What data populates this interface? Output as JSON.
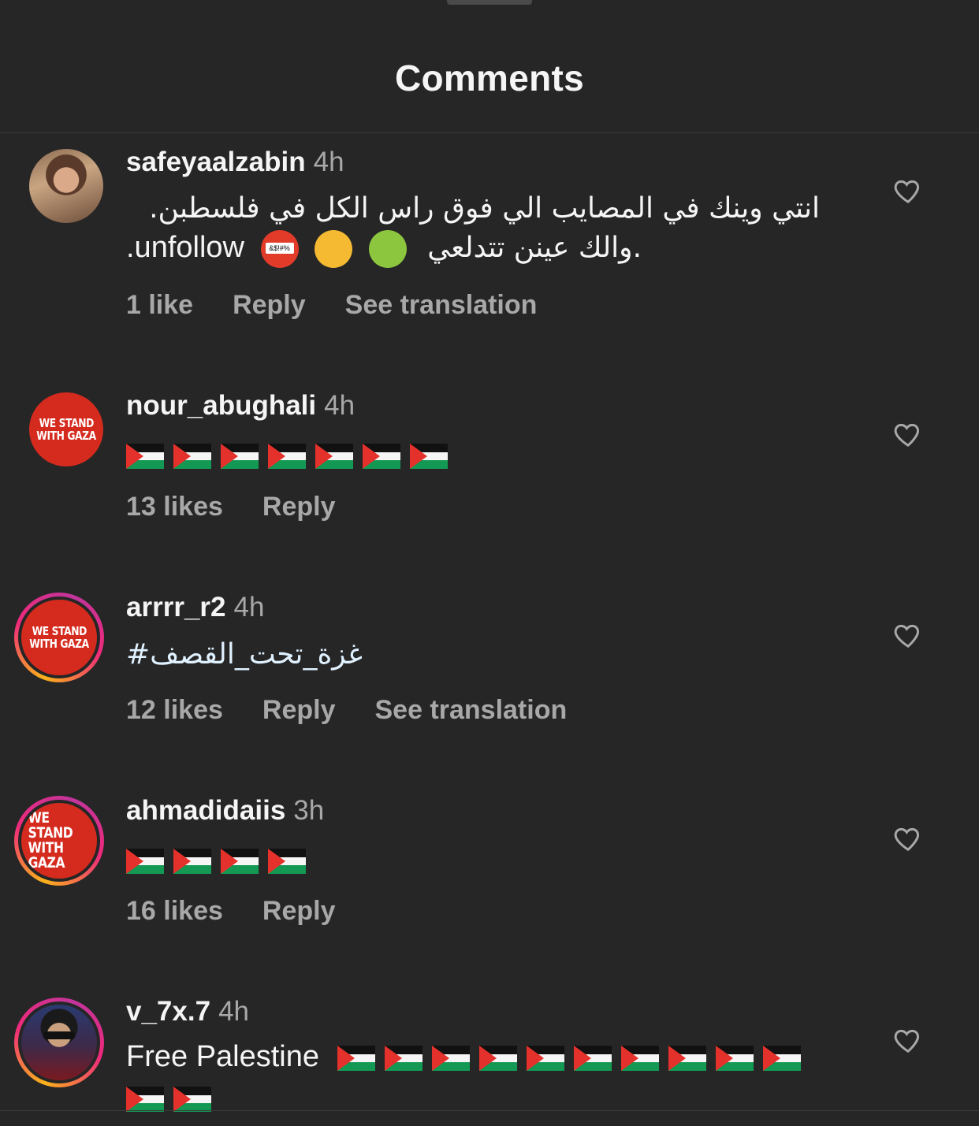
{
  "header": {
    "title": "Comments"
  },
  "comments": [
    {
      "username": "safeyaalzabin",
      "time": "4h",
      "text_line1": "انتي وينك في المصايب الي فوق راس الكل في فلسطبن.",
      "text_line2_arabic": "والك عينن تتدلعي.",
      "text_line2_latin": ".unfollow",
      "emoji_label": "&$!#%",
      "likes": "1 like",
      "reply": "Reply",
      "translate": "See translation"
    },
    {
      "username": "nour_abughali",
      "time": "4h",
      "avatar_line1": "WE STAND",
      "avatar_line2": "WITH GAZA",
      "flag_count": 7,
      "likes": "13 likes",
      "reply": "Reply"
    },
    {
      "username": "arrrr_r2",
      "time": "4h",
      "avatar_line1": "WE STAND",
      "avatar_line2": "WITH GAZA",
      "text": "#غزة_تحت_القصف",
      "likes": "12 likes",
      "reply": "Reply",
      "translate": "See translation"
    },
    {
      "username": "ahmadidaiis",
      "time": "3h",
      "avatar_line1": "WE STAND",
      "avatar_line2": "WITH GAZA",
      "flag_count": 4,
      "likes": "16 likes",
      "reply": "Reply"
    },
    {
      "username": "v_7x.7",
      "time": "4h",
      "text": "Free Palestine",
      "flag_count_line1": 10,
      "flag_count_line2": 2
    }
  ],
  "icons": {
    "like": "heart-outline-icon",
    "flag": "palestine-flag-icon"
  },
  "colors": {
    "background": "#262626",
    "secondary_text": "#a8a8a8",
    "gaza_red": "#d52b1e",
    "hashtag": "#e0f1ff"
  }
}
